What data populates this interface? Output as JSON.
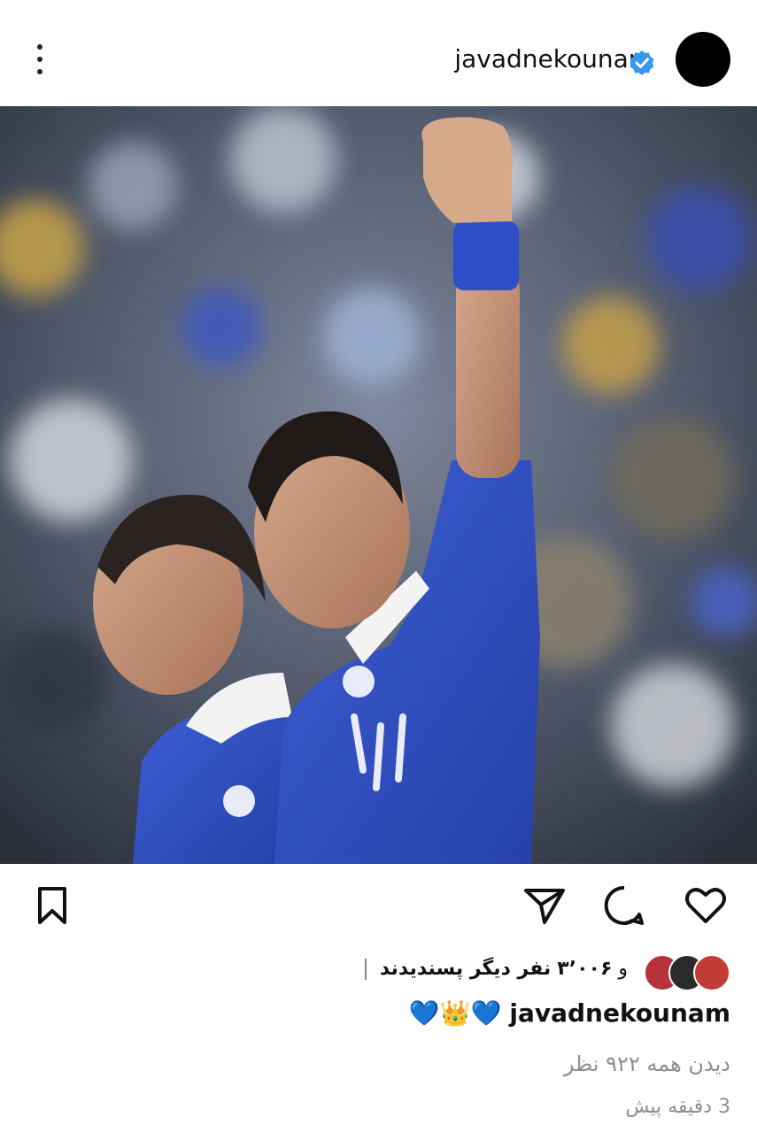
{
  "header": {
    "username": "javadnekounam",
    "more_icon": "more-vertical-icon",
    "verified_icon": "verified-badge-icon"
  },
  "post": {
    "image_desc_icon": "post-photo"
  },
  "actions": {
    "like_icon": "heart-icon",
    "comment_icon": "comment-icon",
    "share_icon": "send-icon",
    "save_icon": "bookmark-icon"
  },
  "likes": {
    "prefix": "و",
    "count": "۳٬۰۰۶",
    "suffix": "نفر دیگر پسندیدند"
  },
  "caption": {
    "username": "javadnekounam",
    "text": "💙👑💙"
  },
  "comments": {
    "view_all": "دیدن همه ۹۲۲ نظر"
  },
  "timestamp": {
    "text": "3 دقیقه پیش"
  },
  "colors": {
    "verified": "#3897f0",
    "team_blue": "#2f4fc9",
    "muted": "#8e8e8e"
  }
}
